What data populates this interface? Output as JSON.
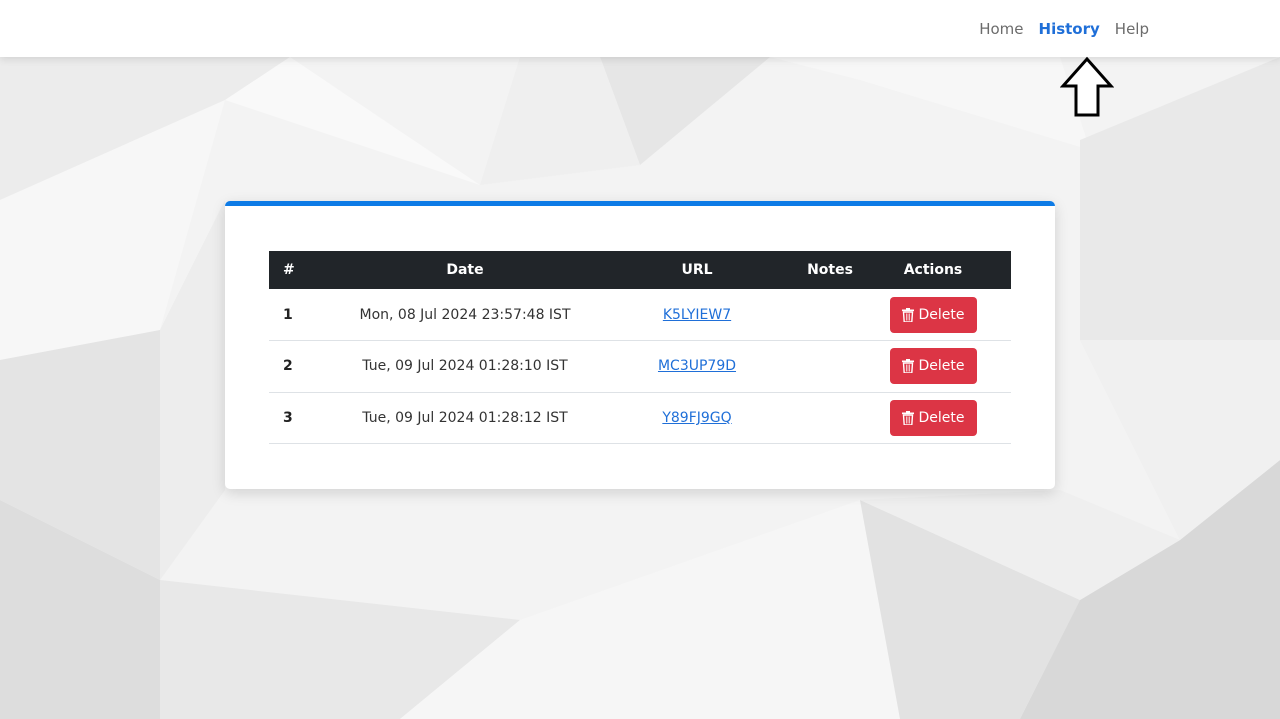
{
  "nav": {
    "items": [
      {
        "label": "Home",
        "active": false
      },
      {
        "label": "History",
        "active": true
      },
      {
        "label": "Help",
        "active": false
      }
    ]
  },
  "table": {
    "headers": {
      "num": "#",
      "date": "Date",
      "url": "URL",
      "notes": "Notes",
      "actions": "Actions"
    },
    "rows": [
      {
        "num": "1",
        "date": "Mon, 08 Jul 2024 23:57:48 IST",
        "url": "K5LYIEW7",
        "notes": "",
        "action": "Delete"
      },
      {
        "num": "2",
        "date": "Tue, 09 Jul 2024 01:28:10 IST",
        "url": "MC3UP79D",
        "notes": "",
        "action": "Delete"
      },
      {
        "num": "3",
        "date": "Tue, 09 Jul 2024 01:28:12 IST",
        "url": "Y89FJ9GQ",
        "notes": "",
        "action": "Delete"
      }
    ]
  },
  "icons": {
    "delete": "trash-icon",
    "pointer": "up-arrow-icon"
  },
  "colors": {
    "accent": "#0d7be6",
    "active_link": "#1f6fd8",
    "danger": "#dc3545",
    "header_bg": "#212529"
  }
}
